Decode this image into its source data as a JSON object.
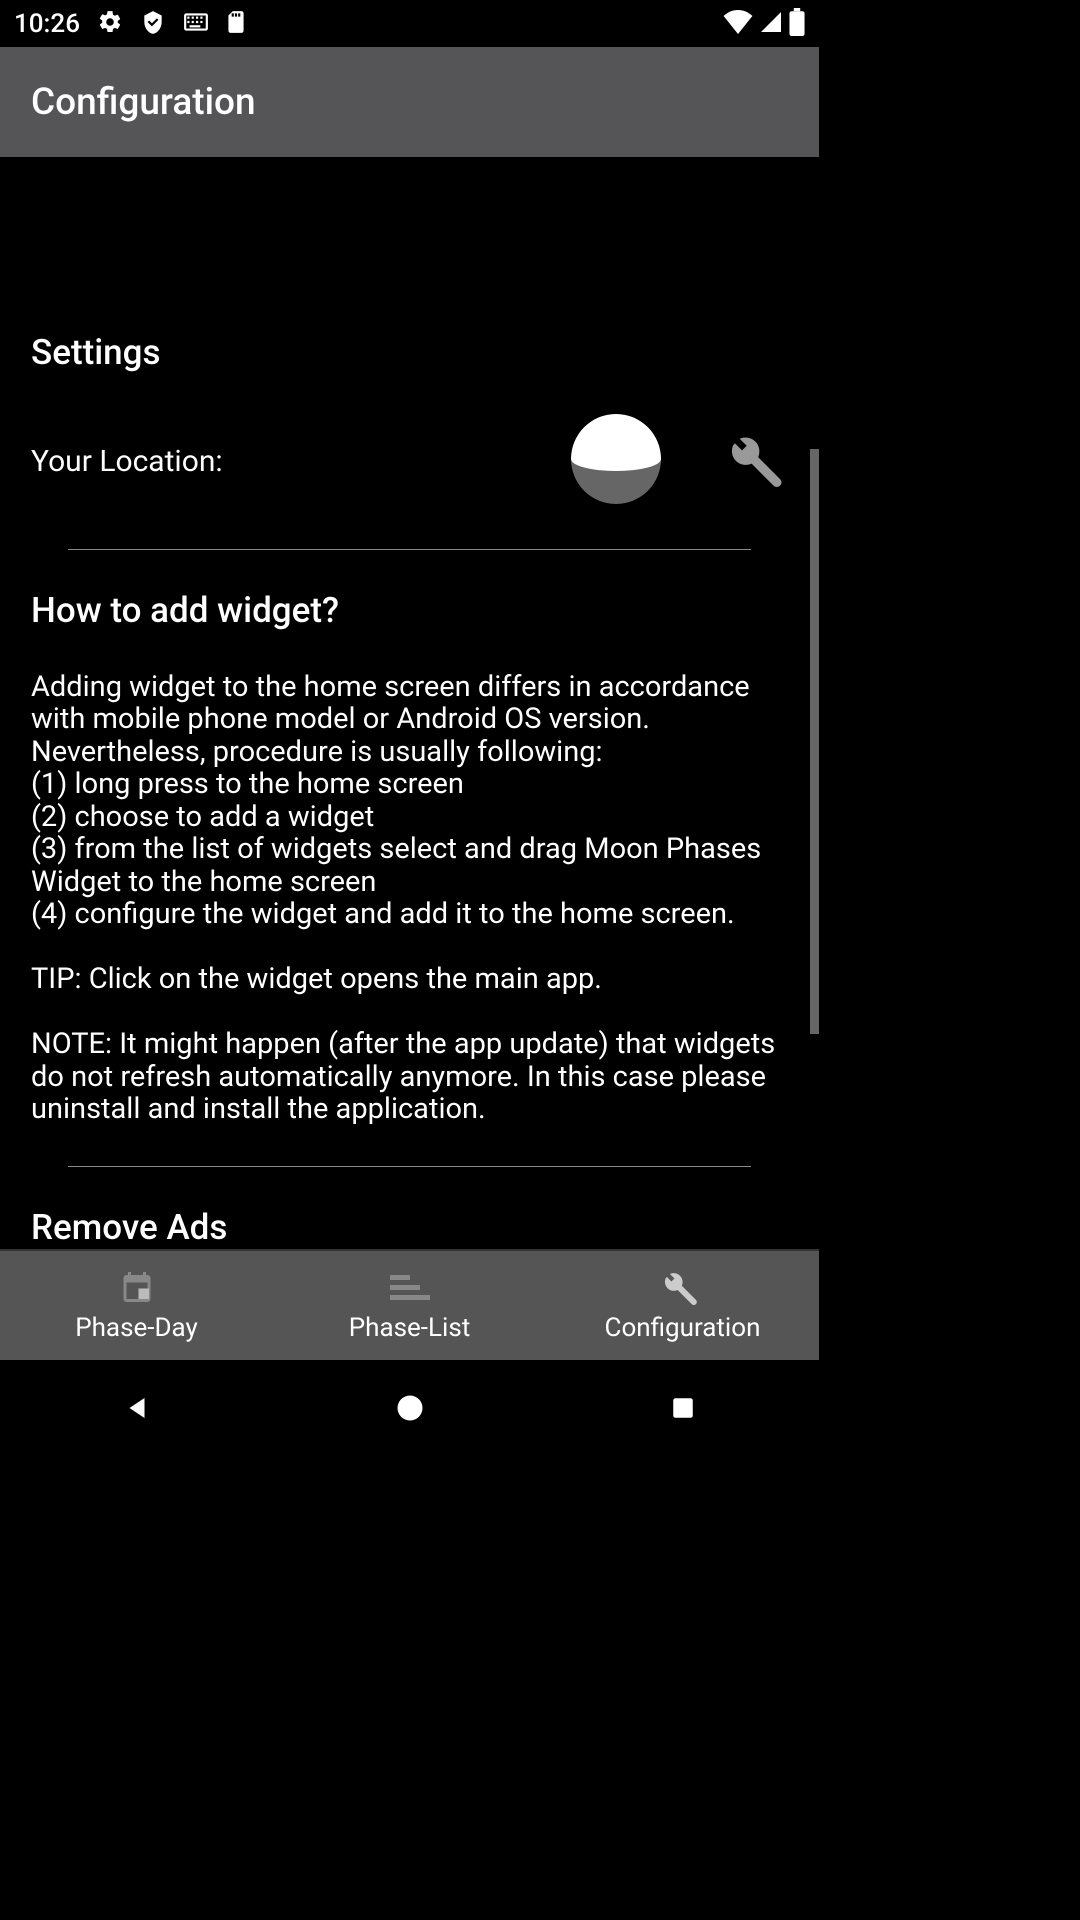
{
  "statusbar": {
    "time": "10:26"
  },
  "appbar": {
    "title": "Configuration"
  },
  "settings": {
    "heading": "Settings",
    "location_label": "Your Location:"
  },
  "howto": {
    "heading": "How to add widget?",
    "body": "Adding widget to the home screen differs in accordance with mobile phone model or Android OS version. Nevertheless, procedure is usually following:\n(1) long press to the home screen\n(2) choose to add a widget\n(3) from the list of widgets select and drag Moon Phases Widget to the home screen\n(4) configure the widget and add it to the home screen.\n\nTIP: Click on the widget opens the main app.\n\nNOTE: It might happen (after the app update) that widgets do not refresh automatically anymore. In this case please uninstall and install the application."
  },
  "removeads": {
    "heading": "Remove Ads"
  },
  "bottomnav": {
    "items": [
      {
        "label": "Phase-Day",
        "icon": "calendar-icon"
      },
      {
        "label": "Phase-List",
        "icon": "list-icon"
      },
      {
        "label": "Configuration",
        "icon": "wrench-icon"
      }
    ]
  }
}
